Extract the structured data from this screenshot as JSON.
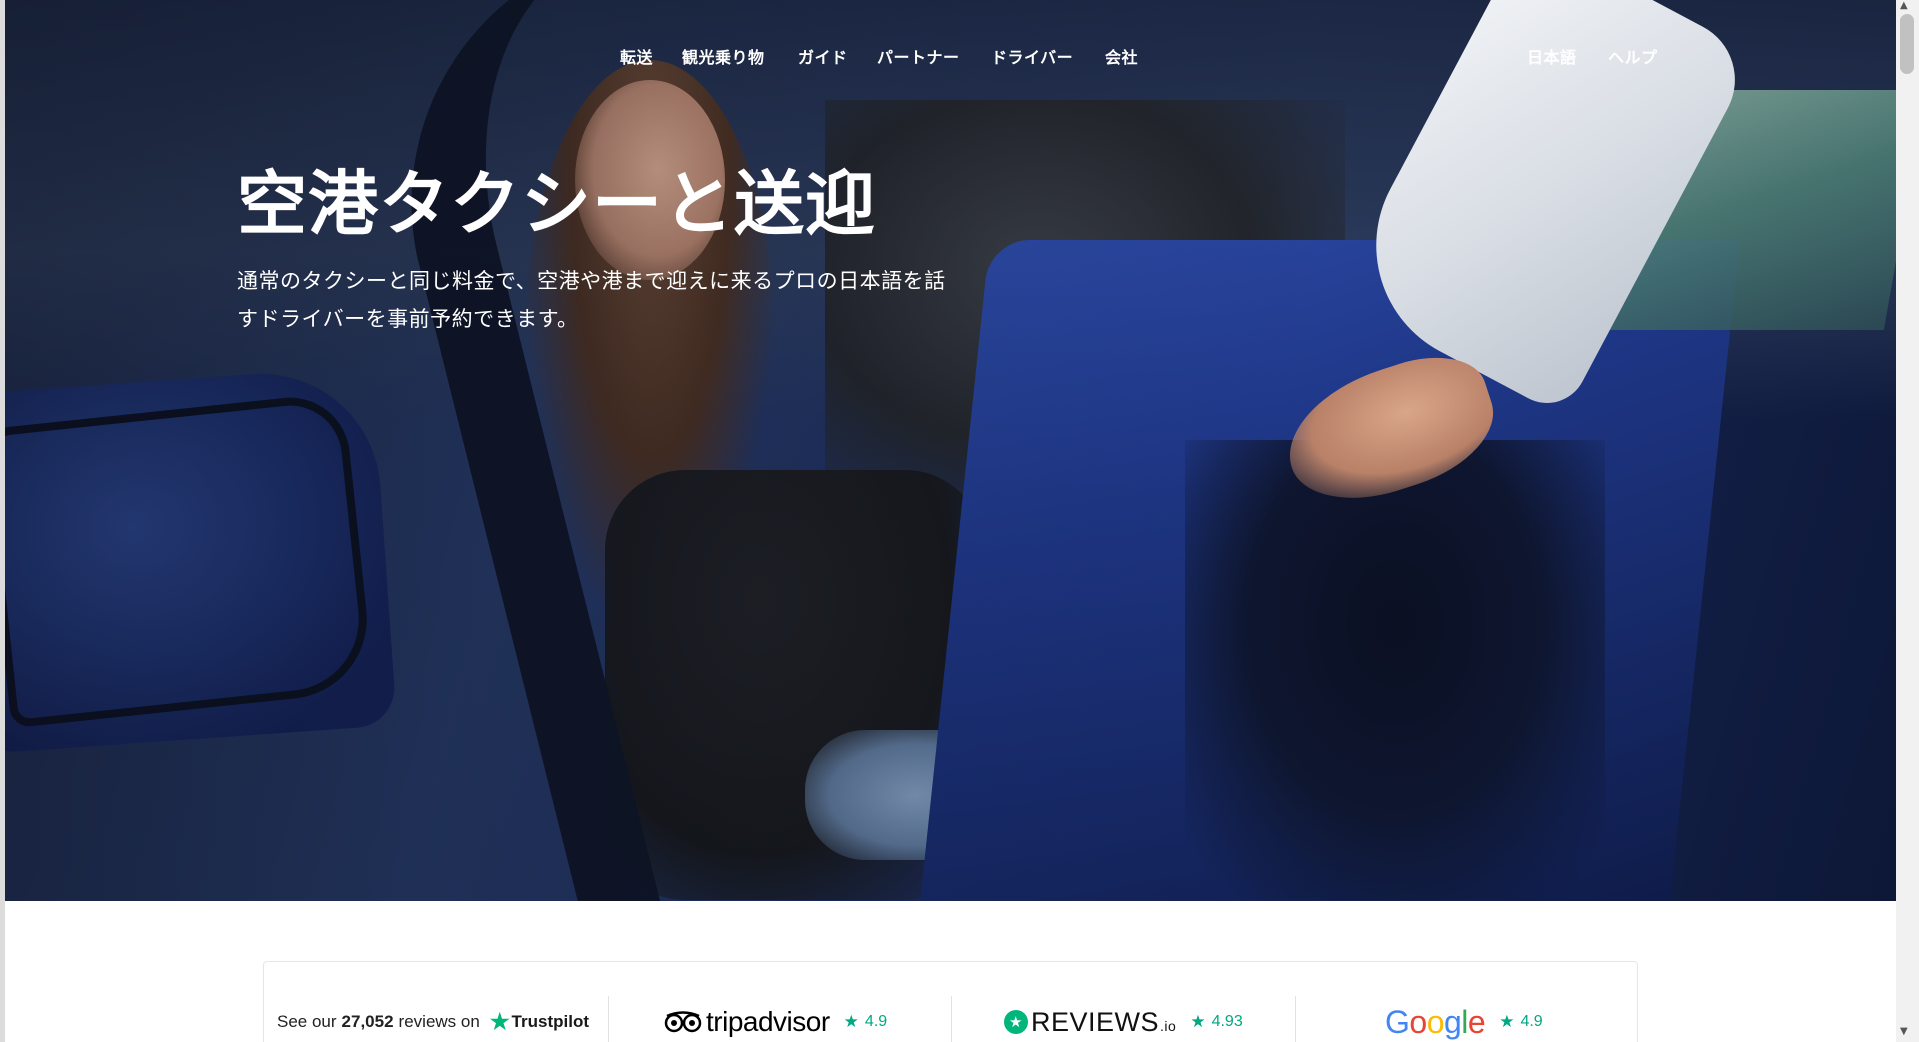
{
  "nav": {
    "items": [
      {
        "label": "転送"
      },
      {
        "label": "観光乗り物"
      },
      {
        "label": "ガイド"
      },
      {
        "label": "パートナー"
      },
      {
        "label": "ドライバー"
      },
      {
        "label": "会社"
      }
    ],
    "language": "日本語",
    "help": "ヘルプ"
  },
  "hero": {
    "title": "空港タクシーと送迎",
    "subtitle": "通常のタクシーと同じ料金で、空港や港まで迎えに来るプロの日本語を話すドライバーを事前予約できます。"
  },
  "reviews": {
    "trustpilot": {
      "prefix": "See our",
      "count": "27,052",
      "suffix": "reviews on",
      "brand": "Trustpilot"
    },
    "tripadvisor": {
      "brand": "tripadvisor",
      "rating": "4.9"
    },
    "reviewsio": {
      "brand": "REVIEWS",
      "brand_suffix": ".io",
      "rating": "4.93"
    },
    "google": {
      "brand": "Google",
      "rating": "4.9"
    }
  },
  "colors": {
    "rating_green": "#00a981",
    "trustpilot_green": "#00b67a",
    "google_blue": "#4285F4",
    "google_red": "#EA4335",
    "google_yellow": "#FBBC05",
    "google_green": "#34A853"
  },
  "icons": {
    "rating": "star-icon",
    "trustpilot": "trustpilot-star-icon",
    "tripadvisor": "tripadvisor-owl-icon",
    "reviewsio": "reviewsio-star-badge-icon"
  }
}
